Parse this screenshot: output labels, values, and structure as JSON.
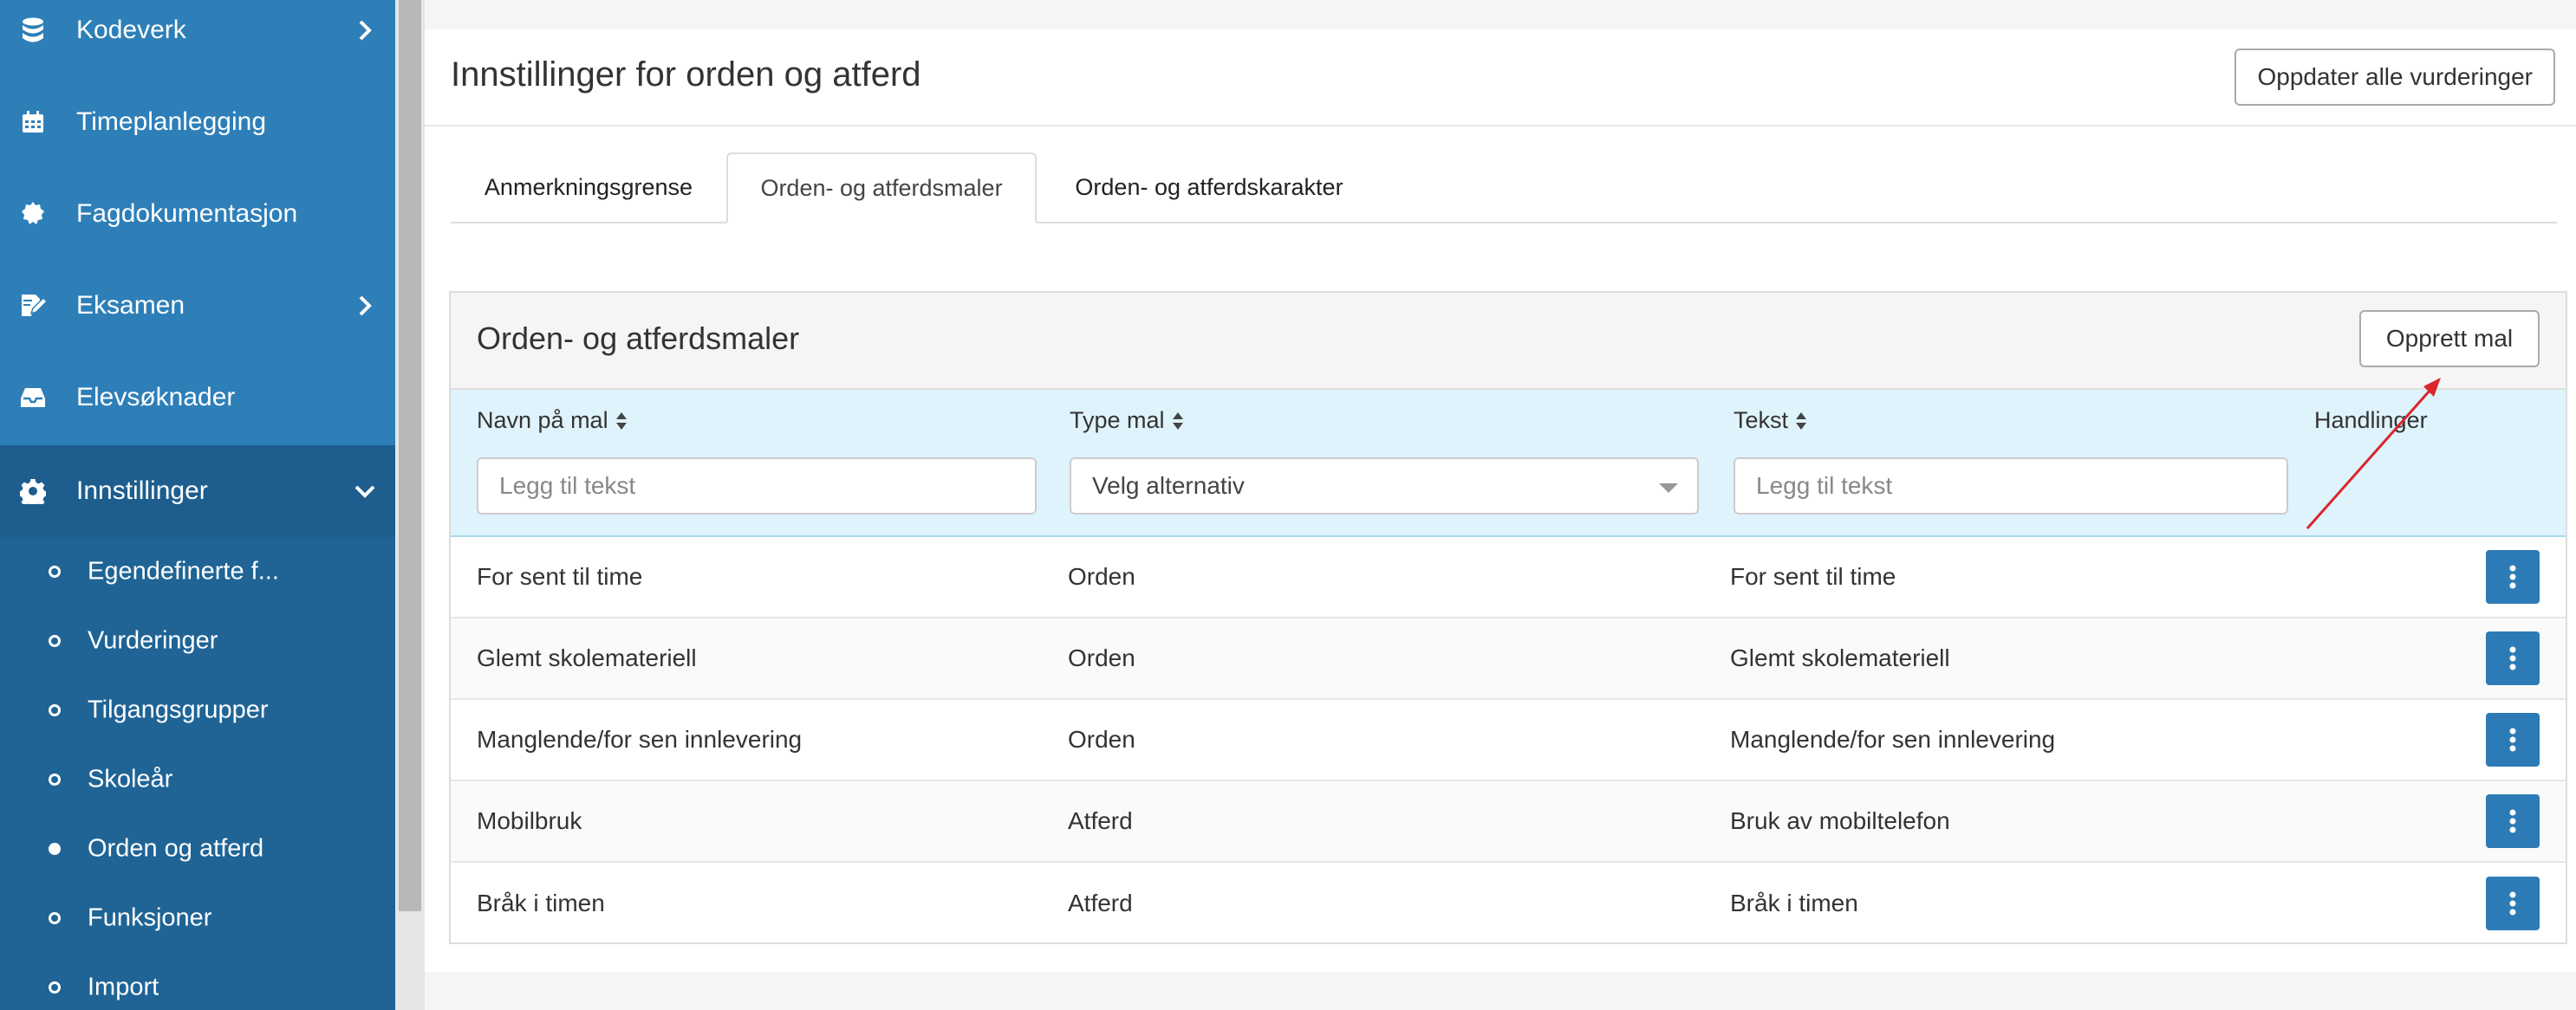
{
  "sidebar": {
    "items": [
      {
        "label": "Kodeverk",
        "icon": "database-icon"
      },
      {
        "label": "Timeplanlegging",
        "icon": "calendar-icon"
      },
      {
        "label": "Fagdokumentasjon",
        "icon": "cog-badge-icon"
      },
      {
        "label": "Eksamen",
        "icon": "signature-icon"
      },
      {
        "label": "Elevsøknader",
        "icon": "inbox-icon"
      },
      {
        "label": "Innstillinger",
        "icon": "gear-icon"
      }
    ],
    "sub_items": [
      {
        "label": "Egendefinerte f..."
      },
      {
        "label": "Vurderinger"
      },
      {
        "label": "Tilgangsgrupper"
      },
      {
        "label": "Skoleår"
      },
      {
        "label": "Orden og atferd"
      },
      {
        "label": "Funksjoner"
      },
      {
        "label": "Import"
      }
    ]
  },
  "header": {
    "title": "Innstillinger for orden og atferd",
    "update_button": "Oppdater alle vurderinger"
  },
  "tabs": [
    {
      "label": "Anmerkningsgrense"
    },
    {
      "label": "Orden- og atferdsmaler"
    },
    {
      "label": "Orden- og atferdskarakter"
    }
  ],
  "panel": {
    "title": "Orden- og atferdsmaler",
    "create_button": "Opprett mal"
  },
  "table": {
    "columns": {
      "name": "Navn på mal",
      "type": "Type mal",
      "text": "Tekst",
      "actions": "Handlinger"
    },
    "filters": {
      "name_placeholder": "Legg til tekst",
      "type_placeholder": "Velg alternativ",
      "text_placeholder": "Legg til tekst"
    },
    "rows": [
      {
        "name": "For sent til time",
        "type": "Orden",
        "text": "For sent til time"
      },
      {
        "name": "Glemt skolemateriell",
        "type": "Orden",
        "text": "Glemt skolemateriell"
      },
      {
        "name": "Manglende/for sen innlevering",
        "type": "Orden",
        "text": "Manglende/for sen innlevering"
      },
      {
        "name": "Mobilbruk",
        "type": "Atferd",
        "text": "Bruk av mobiltelefon"
      },
      {
        "name": "Bråk i timen",
        "type": "Atferd",
        "text": "Bråk i timen"
      }
    ]
  },
  "colors": {
    "sidebar": "#2e7fb8",
    "sidebar_active": "#1f6495",
    "accent": "#2c7bb6",
    "filter_bg": "#dff3fc",
    "annotation_arrow": "#d9262c"
  }
}
